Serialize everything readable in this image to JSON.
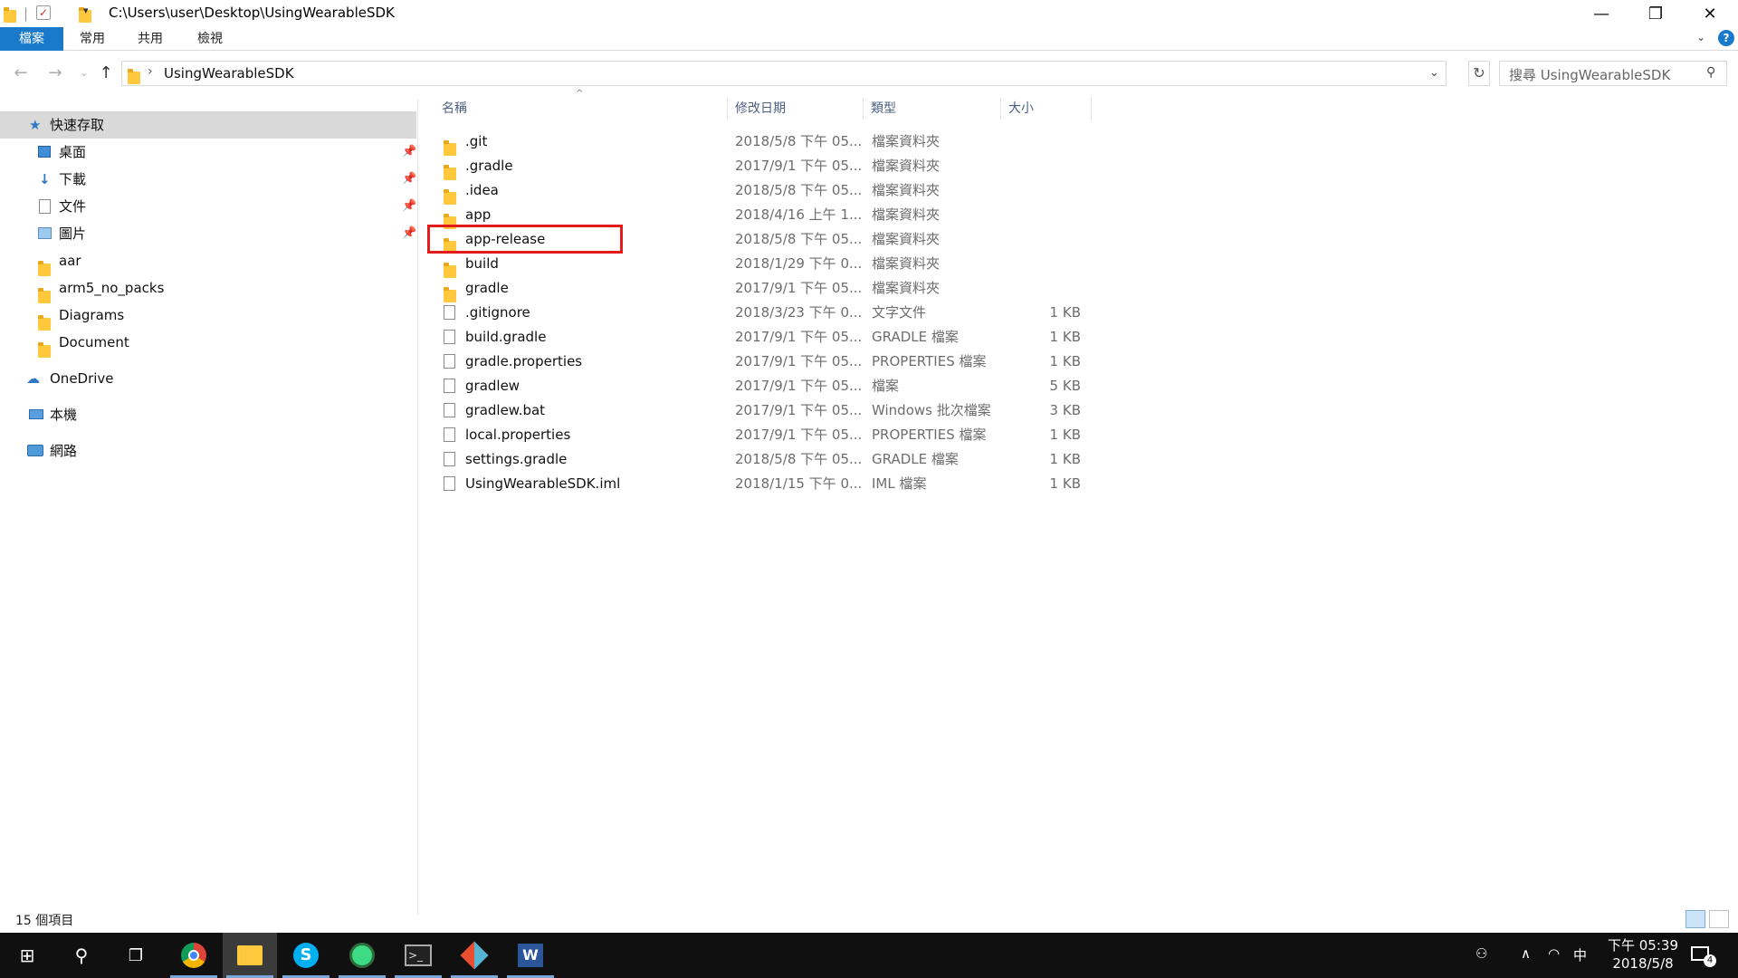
{
  "titlebar": {
    "path": "C:\\Users\\user\\Desktop\\UsingWearableSDK",
    "minimize_glyph": "—",
    "restore_glyph": "❐",
    "close_glyph": "✕"
  },
  "ribbon": {
    "tabs": [
      "檔案",
      "常用",
      "共用",
      "檢視"
    ],
    "help_glyph": "?"
  },
  "address": {
    "current": "UsingWearableSDK",
    "search_placeholder": "搜尋 UsingWearableSDK"
  },
  "nav": {
    "quick_access": "快速存取",
    "pinned": [
      {
        "label": "桌面",
        "icon": "desktop-icon"
      },
      {
        "label": "下載",
        "icon": "download-icon"
      },
      {
        "label": "文件",
        "icon": "documents-icon"
      },
      {
        "label": "圖片",
        "icon": "pictures-icon"
      }
    ],
    "recent": [
      "aar",
      "arm5_no_packs",
      "Diagrams",
      "Document"
    ],
    "onedrive": "OneDrive",
    "this_pc": "本機",
    "network": "網路"
  },
  "columns": {
    "name": "名稱",
    "date": "修改日期",
    "type": "類型",
    "size": "大小"
  },
  "files": [
    {
      "name": ".git",
      "date": "2018/5/8 下午 05...",
      "type": "檔案資料夾",
      "size": "",
      "kind": "folder"
    },
    {
      "name": ".gradle",
      "date": "2017/9/1 下午 05...",
      "type": "檔案資料夾",
      "size": "",
      "kind": "folder"
    },
    {
      "name": ".idea",
      "date": "2018/5/8 下午 05...",
      "type": "檔案資料夾",
      "size": "",
      "kind": "folder"
    },
    {
      "name": "app",
      "date": "2018/4/16 上午 1...",
      "type": "檔案資料夾",
      "size": "",
      "kind": "folder"
    },
    {
      "name": "app-release",
      "date": "2018/5/8 下午 05...",
      "type": "檔案資料夾",
      "size": "",
      "kind": "folder"
    },
    {
      "name": "build",
      "date": "2018/1/29 下午 0...",
      "type": "檔案資料夾",
      "size": "",
      "kind": "folder"
    },
    {
      "name": "gradle",
      "date": "2017/9/1 下午 05...",
      "type": "檔案資料夾",
      "size": "",
      "kind": "folder"
    },
    {
      "name": ".gitignore",
      "date": "2018/3/23 下午 0...",
      "type": "文字文件",
      "size": "1 KB",
      "kind": "file"
    },
    {
      "name": "build.gradle",
      "date": "2017/9/1 下午 05...",
      "type": "GRADLE 檔案",
      "size": "1 KB",
      "kind": "file"
    },
    {
      "name": "gradle.properties",
      "date": "2017/9/1 下午 05...",
      "type": "PROPERTIES 檔案",
      "size": "1 KB",
      "kind": "file"
    },
    {
      "name": "gradlew",
      "date": "2017/9/1 下午 05...",
      "type": "檔案",
      "size": "5 KB",
      "kind": "file"
    },
    {
      "name": "gradlew.bat",
      "date": "2017/9/1 下午 05...",
      "type": "Windows 批次檔案",
      "size": "3 KB",
      "kind": "file"
    },
    {
      "name": "local.properties",
      "date": "2017/9/1 下午 05...",
      "type": "PROPERTIES 檔案",
      "size": "1 KB",
      "kind": "file"
    },
    {
      "name": "settings.gradle",
      "date": "2018/5/8 下午 05...",
      "type": "GRADLE 檔案",
      "size": "1 KB",
      "kind": "file"
    },
    {
      "name": "UsingWearableSDK.iml",
      "date": "2018/1/15 下午 0...",
      "type": "IML 檔案",
      "size": "1 KB",
      "kind": "file"
    }
  ],
  "status": {
    "count": "15 個項目"
  },
  "taskbar": {
    "apps": [
      "chrome-icon",
      "file-explorer-icon",
      "skype-icon",
      "android-studio-icon",
      "terminal-icon",
      "git-icon",
      "word-icon"
    ],
    "ime": "中",
    "time": "下午 05:39",
    "date": "2018/5/8",
    "notification_count": "4"
  },
  "colors": {
    "accent": "#1979ca",
    "highlight": "#e21b1b",
    "folder": "#ffc83d"
  }
}
